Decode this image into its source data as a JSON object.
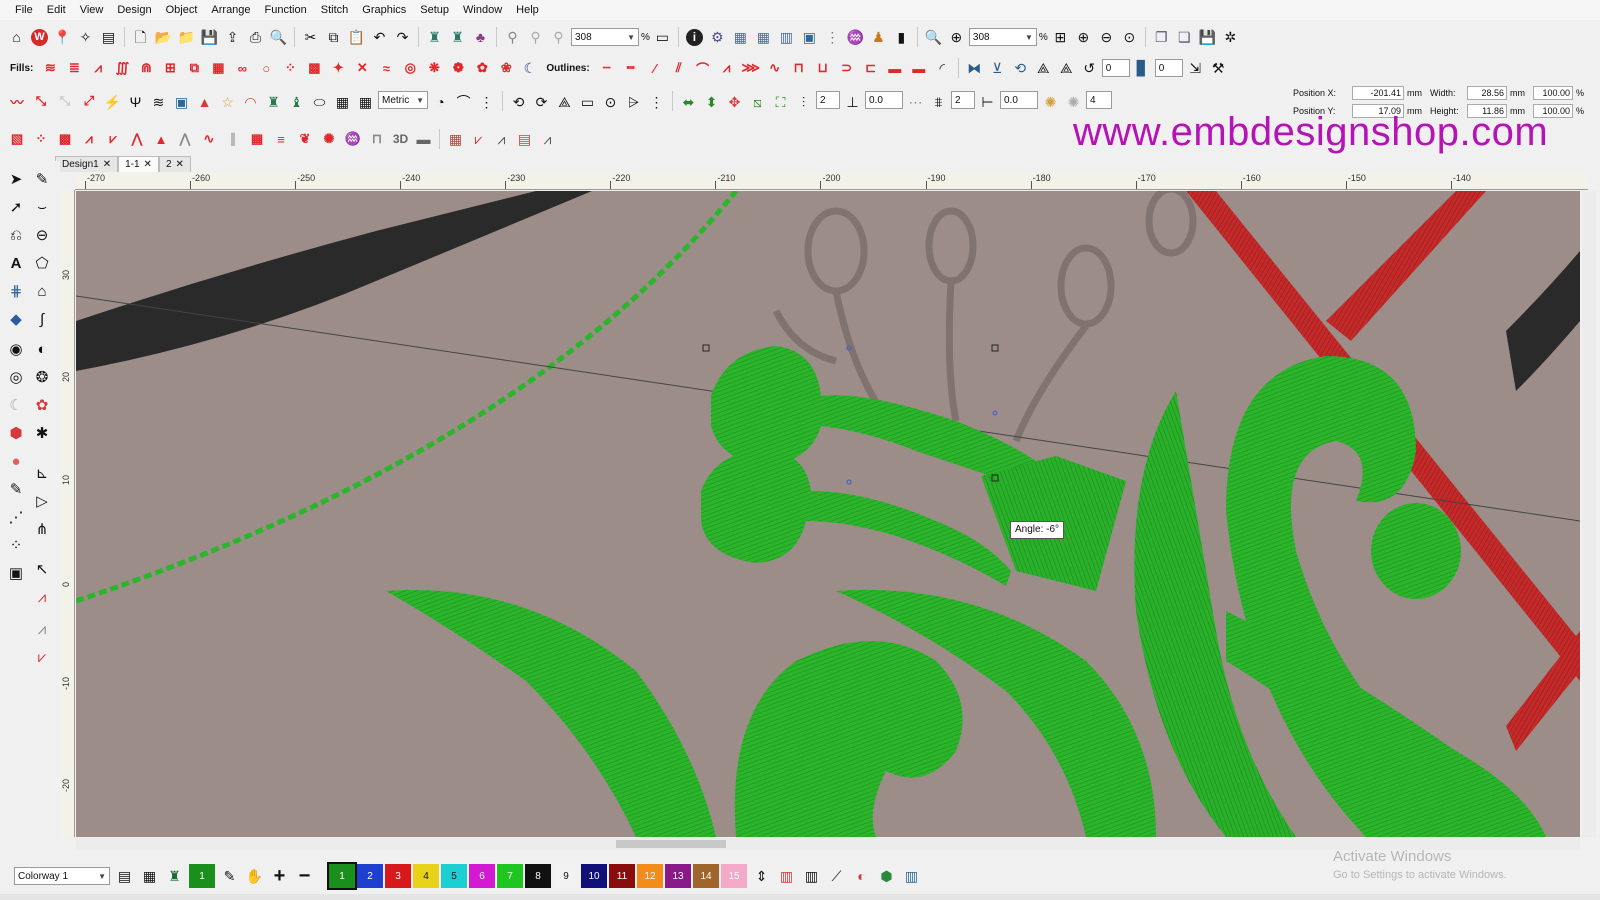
{
  "menu": [
    "File",
    "Edit",
    "View",
    "Design",
    "Object",
    "Arrange",
    "Function",
    "Stitch",
    "Graphics",
    "Setup",
    "Window",
    "Help"
  ],
  "toolbar1": {
    "zoom_value": "308",
    "zoom_unit": "%",
    "zoom_value2": "308",
    "zoom_unit2": "%"
  },
  "toolbar2": {
    "fills_label": "Fills:",
    "outlines_label": "Outlines:",
    "spin1": "0",
    "spin2": "0"
  },
  "toolbar3": {
    "units_value": "Metric",
    "spin_a": "2",
    "spin_b": "0.0",
    "spin_c": "2",
    "spin_d": "0.0",
    "spin_e": "4"
  },
  "position": {
    "pos_x_label": "Position X:",
    "pos_x_value": "-201.41",
    "pos_x_unit": "mm",
    "pos_y_label": "Position Y:",
    "pos_y_value": "17.09",
    "pos_y_unit": "mm",
    "width_label": "Width:",
    "width_value": "28.56",
    "width_unit": "mm",
    "width_pct": "100.00",
    "width_pct_unit": "%",
    "height_label": "Height:",
    "height_value": "11.86",
    "height_unit": "mm",
    "height_pct": "100.00",
    "height_pct_unit": "%"
  },
  "watermark": "www.embdesignshop.com",
  "tabs": [
    {
      "label": "Design1"
    },
    {
      "label": "1-1"
    },
    {
      "label": "2"
    }
  ],
  "ruler_h": [
    "-270",
    "-260",
    "-250",
    "-240",
    "-230",
    "-220",
    "-210",
    "-200",
    "-190",
    "-180",
    "-170",
    "-160",
    "-150",
    "-140"
  ],
  "ruler_v": [
    "30",
    "20",
    "10",
    "0",
    "-10",
    "-20"
  ],
  "tooltip": "Angle: -6°",
  "colorway": {
    "value": "Colorway 1"
  },
  "palette": [
    {
      "num": "1",
      "color": "#1b8f1b"
    },
    {
      "num": "2",
      "color": "#1f3fcf"
    },
    {
      "num": "3",
      "color": "#d7191c"
    },
    {
      "num": "4",
      "color": "#e8d219"
    },
    {
      "num": "5",
      "color": "#1ccfd2"
    },
    {
      "num": "6",
      "color": "#d11ad2"
    },
    {
      "num": "7",
      "color": "#20c620"
    },
    {
      "num": "8",
      "color": "#111111"
    },
    {
      "num": "9",
      "color": "#f2f2f2"
    },
    {
      "num": "10",
      "color": "#10107a"
    },
    {
      "num": "11",
      "color": "#8a0d0d"
    },
    {
      "num": "12",
      "color": "#f28c1a"
    },
    {
      "num": "13",
      "color": "#8a1a8a"
    },
    {
      "num": "14",
      "color": "#a0652a"
    },
    {
      "num": "15",
      "color": "#f5a9c8"
    }
  ],
  "windows_notice": {
    "title": "Activate Windows",
    "subtitle": "Go to Settings to activate Windows."
  }
}
